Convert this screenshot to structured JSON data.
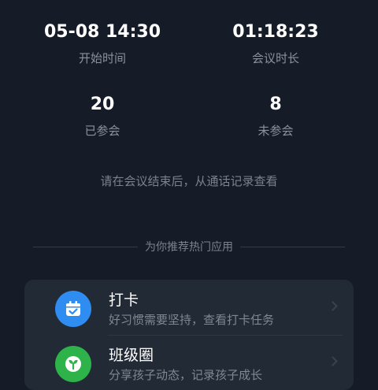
{
  "stats": {
    "start_time": {
      "value": "05-08 14:30",
      "label": "开始时间"
    },
    "duration": {
      "value": "01:18:23",
      "label": "会议时长"
    },
    "joined": {
      "value": "20",
      "label": "已参会"
    },
    "absent": {
      "value": "8",
      "label": "未参会"
    }
  },
  "hint": "请在会议结束后，从通话记录查看",
  "recommend_title": "为你推荐热门应用",
  "apps": [
    {
      "name": "打卡",
      "desc": "好习惯需要坚持，查看打卡任务",
      "icon": "calendar-check-icon",
      "color": "#2f8cf0"
    },
    {
      "name": "班级圈",
      "desc": "分享孩子动态，记录孩子成长",
      "icon": "sprout-icon",
      "color": "#2db34a"
    }
  ]
}
